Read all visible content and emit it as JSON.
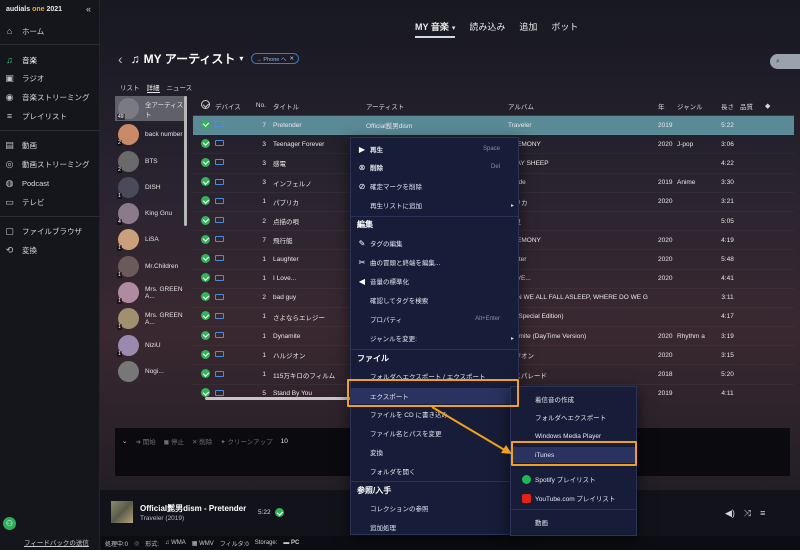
{
  "app": {
    "brand": "audials",
    "brand_accent": "one",
    "brand_year": "2021"
  },
  "sidebar": {
    "items": [
      {
        "label": "ホーム",
        "icon": "home-icon"
      },
      {
        "label": "音楽",
        "icon": "music-icon",
        "active": true
      },
      {
        "label": "ラジオ",
        "icon": "radio-icon"
      },
      {
        "label": "音楽ストリーミング",
        "icon": "music-streaming-icon"
      },
      {
        "label": "プレイリスト",
        "icon": "playlist-icon"
      },
      {
        "label": "動画",
        "icon": "video-icon"
      },
      {
        "label": "動画ストリーミング",
        "icon": "video-streaming-icon"
      },
      {
        "label": "Podcast",
        "icon": "podcast-icon"
      },
      {
        "label": "テレビ",
        "icon": "tv-icon"
      },
      {
        "label": "ファイルブラウザ",
        "icon": "file-browser-icon"
      },
      {
        "label": "変換",
        "icon": "convert-icon"
      }
    ],
    "feedback": "フィードバックの送信"
  },
  "topnav": {
    "my_music": "MY 音楽",
    "import": "読み込み",
    "add": "追加",
    "bot": "ボット"
  },
  "header": {
    "title": "MY アーティスト",
    "chip": "→ Phone へ"
  },
  "subtabs": {
    "list": "リスト",
    "detail": "詳細",
    "news": "ニュース"
  },
  "artists": [
    {
      "name": "全アーティスト",
      "count": "49"
    },
    {
      "name": "back number",
      "count": "2"
    },
    {
      "name": "BTS",
      "count": "2"
    },
    {
      "name": "DISH",
      "count": "1"
    },
    {
      "name": "King Gnu",
      "count": "4"
    },
    {
      "name": "LiSA",
      "count": "1"
    },
    {
      "name": "Mr.Children",
      "count": "1"
    },
    {
      "name": "Mrs. GREEN A...",
      "count": "1"
    },
    {
      "name": "Mrs. GREEN A...",
      "count": "1"
    },
    {
      "name": "NiziU",
      "count": "1"
    },
    {
      "name": "Nogi...",
      "count": ""
    }
  ],
  "table": {
    "headers": {
      "device": "デバイス",
      "no": "No.",
      "title": "タイトル",
      "artist": "アーティスト",
      "album": "アルバム",
      "year": "年",
      "genre": "ジャンル",
      "length": "長さ",
      "quality": "品質"
    },
    "rows": [
      {
        "no": "7",
        "title": "Pretender",
        "artist": "Official髭男dism",
        "album": "Traveler",
        "year": "2019",
        "genre": "",
        "length": "5:22"
      },
      {
        "no": "3",
        "title": "Teenager Forever",
        "artist": "",
        "album": "EREMONY",
        "year": "2020",
        "genre": "J-pop",
        "length": "3:06"
      },
      {
        "no": "3",
        "title": "感電",
        "artist": "",
        "album": "TRAY SHEEP",
        "year": "",
        "genre": "",
        "length": "4:22"
      },
      {
        "no": "3",
        "title": "インフェルノ",
        "artist": "",
        "album": "ttitude",
        "year": "2019",
        "genre": "Anime",
        "length": "3:30"
      },
      {
        "no": "1",
        "title": "パプリカ",
        "artist": "",
        "album": "プリカ",
        "year": "2020",
        "genre": "",
        "length": "3:21"
      },
      {
        "no": "2",
        "title": "点描の唄",
        "artist": "",
        "album": "と夏",
        "year": "",
        "genre": "",
        "length": "5:05"
      },
      {
        "no": "7",
        "title": "飛行艇",
        "artist": "",
        "album": "EREMONY",
        "year": "2020",
        "genre": "",
        "length": "4:19"
      },
      {
        "no": "1",
        "title": "Laughter",
        "artist": "",
        "album": "ughter",
        "year": "2020",
        "genre": "",
        "length": "5:48"
      },
      {
        "no": "1",
        "title": "I Love...",
        "artist": "",
        "album": "LOVE...",
        "year": "2020",
        "genre": "",
        "length": "4:41"
      },
      {
        "no": "2",
        "title": "bad guy",
        "artist": "",
        "album": "HEN WE ALL FALL ASLEEP, WHERE DO WE G",
        "year": "",
        "genre": "",
        "length": "3:11"
      },
      {
        "no": "1",
        "title": "さよならエレジー",
        "artist": "",
        "album": "AY(Special Edition)",
        "year": "",
        "genre": "",
        "length": "4:17"
      },
      {
        "no": "1",
        "title": "Dynamite",
        "artist": "",
        "album": "ynamite (DayTime Version)",
        "year": "2020",
        "genre": "Rhythm a",
        "length": "3:19"
      },
      {
        "no": "1",
        "title": "ハルジオン",
        "artist": "",
        "album": "ルジオン",
        "year": "2020",
        "genre": "",
        "length": "3:15"
      },
      {
        "no": "1",
        "title": "115万キロのフィルム",
        "artist": "",
        "album": "ンスパレード",
        "year": "2018",
        "genre": "",
        "length": "5:20"
      },
      {
        "no": "5",
        "title": "Stand By You",
        "artist": "",
        "album": "",
        "year": "2019",
        "genre": "",
        "length": "4:11"
      }
    ]
  },
  "context_menu": {
    "play": "再生",
    "play_sc": "Space",
    "delete": "削除",
    "delete_sc": "Del",
    "remove_check": "確定マークを削除",
    "add_to_playlist": "再生リストに追加",
    "edit_header": "編集",
    "edit_tags": "タグの編集",
    "edit_start_end": "曲の冒頭と終端を編集...",
    "normalize": "音量の標準化",
    "check_tags": "確認してタグを検索",
    "properties": "プロパティ",
    "properties_sc": "Alt+Enter",
    "change_genre": "ジャンルを変更:",
    "file_header": "ファイル",
    "export_to_folder": "フォルダへエクスポート / エクスポート",
    "export": "エクスポート",
    "burn_cd": "ファイルを CD に書き込み",
    "rename": "ファイル名とパスを変更",
    "convert": "変換",
    "open_folder": "フォルダを開く",
    "ref_header": "参照/入手",
    "collection_ref": "コレクションの参照",
    "more": "追加処理"
  },
  "export_submenu": {
    "ringtone": "着信音の作成",
    "to_folder": "フォルダへエクスポート",
    "wmp": "Windows Media Player",
    "itunes": "iTunes",
    "spotify": "Spotify プレイリスト",
    "youtube": "YouTube.com プレイリスト",
    "video": "動画"
  },
  "queue_bar": {
    "start": "開始",
    "stop": "停止",
    "delete": "削除",
    "cleanup": "クリーンアップ",
    "count": "10"
  },
  "player": {
    "title": "Official髭男dism - Pretender",
    "sub": "Traveler (2019)",
    "time": "5:22"
  },
  "statusbar": {
    "processing": "処理中:0",
    "format": "形式:",
    "wma": "WMA",
    "wmv": "WMV",
    "filter": "フィルタ:0",
    "storage": "Storage:",
    "pc": "PC"
  },
  "colors": {
    "accent": "#39c26b",
    "highlight": "#f0a01c",
    "selected_row": "#5a8a96",
    "menu_bg": "#171d38"
  }
}
